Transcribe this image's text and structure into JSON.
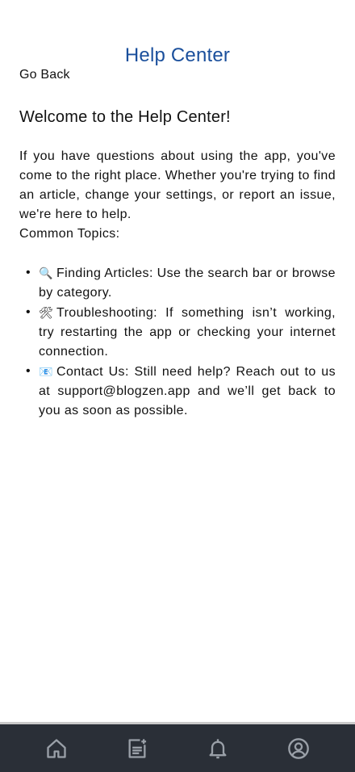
{
  "header": {
    "title": "Help Center",
    "back_label": "Go Back"
  },
  "main": {
    "welcome": "Welcome to the Help Center!",
    "intro": "If you have questions about using the app, you've come to the right place. Whether you're trying to find an article, change your settings, or report an issue, we're here to help.",
    "topics_label": "Common Topics:",
    "topics": [
      {
        "icon": "🔍",
        "icon_name": "magnifying-glass-icon",
        "text": "Finding Articles: Use the search bar or browse by category."
      },
      {
        "icon": "🛠",
        "icon_name": "tools-icon",
        "text": "Troubleshooting: If something isn’t working, try restarting the app or checking your internet connection."
      },
      {
        "icon": "📧",
        "icon_name": "email-icon",
        "text": "Contact Us: Still need help? Reach out to us at support@blogzen.app and we’ll get back to you as soon as possible."
      }
    ]
  },
  "bottom_nav": {
    "items": [
      "home-icon",
      "articles-icon",
      "notifications-icon",
      "profile-icon"
    ]
  },
  "colors": {
    "title": "#1a4f9c",
    "nav_bg": "#2a2f37",
    "nav_icon": "#9aa0a8"
  }
}
